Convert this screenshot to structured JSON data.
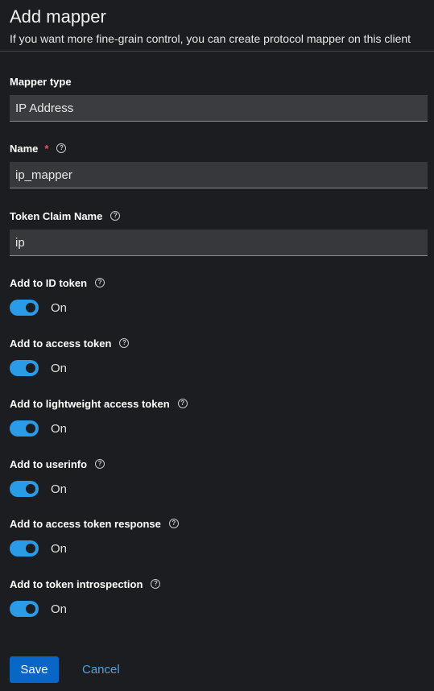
{
  "header": {
    "title": "Add mapper",
    "subtitle": "If you want more fine-grain control, you can create protocol mapper on this client"
  },
  "fields": {
    "mapper_type": {
      "label": "Mapper type",
      "value": "IP Address"
    },
    "name": {
      "label": "Name",
      "required_mark": "*",
      "value": "ip_mapper"
    },
    "token_claim_name": {
      "label": "Token Claim Name",
      "value": "ip"
    }
  },
  "toggles": [
    {
      "label": "Add to ID token",
      "state": "On",
      "on": true
    },
    {
      "label": "Add to access token",
      "state": "On",
      "on": true
    },
    {
      "label": "Add to lightweight access token",
      "state": "On",
      "on": true
    },
    {
      "label": "Add to userinfo",
      "state": "On",
      "on": true
    },
    {
      "label": "Add to access token response",
      "state": "On",
      "on": true
    },
    {
      "label": "Add to token introspection",
      "state": "On",
      "on": true
    }
  ],
  "help_glyph": "?",
  "actions": {
    "save_label": "Save",
    "cancel_label": "Cancel"
  },
  "colors": {
    "accent": "#2a9be6",
    "primary_button": "#0a66c6",
    "link": "#4aa4e8",
    "required": "#f0554a",
    "background": "#1b1d21"
  }
}
